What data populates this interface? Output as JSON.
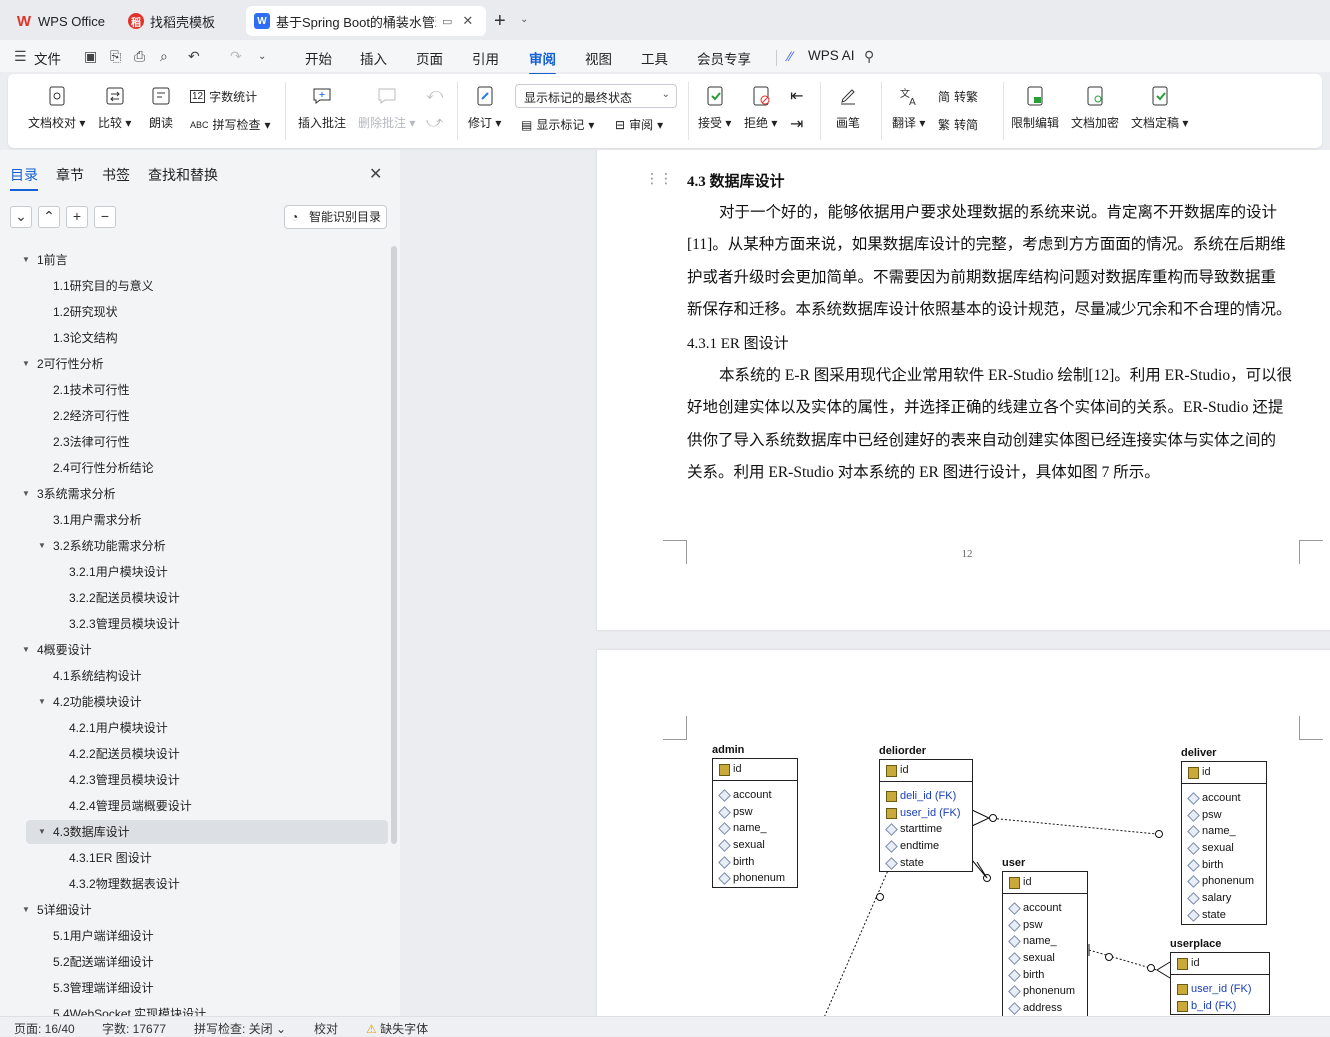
{
  "tabs": [
    {
      "label": "WPS Office",
      "icon": "wps-logo-icon"
    },
    {
      "label": "找稻壳模板",
      "icon": "docer-icon"
    },
    {
      "label": "基于Spring Boot的桶装水管理",
      "icon": "word-doc-icon"
    }
  ],
  "menu": {
    "file": "文件",
    "items": [
      "开始",
      "插入",
      "页面",
      "引用",
      "审阅",
      "视图",
      "工具",
      "会员专享"
    ],
    "active": "审阅",
    "ai": "WPS AI"
  },
  "ribbon": {
    "doc_check": "文档校对",
    "compare": "比较",
    "read_aloud": "朗读",
    "word_count": "字数统计",
    "spell_check": "拼写检查",
    "insert_comment": "插入批注",
    "delete_comment": "删除批注",
    "revise": "修订",
    "markup_state": "显示标记的最终状态",
    "show_markup": "显示标记",
    "review": "审阅",
    "accept": "接受",
    "reject": "拒绝",
    "pen": "画笔",
    "translate": "翻译",
    "to_traditional": "转繁",
    "to_simplified": "转简",
    "traditional_glyph": "繁",
    "restrict_edit": "限制编辑",
    "encrypt": "文档加密",
    "finalize": "文档定稿"
  },
  "nav": {
    "tabs": [
      "目录",
      "章节",
      "书签",
      "查找和替换"
    ],
    "smart_toc": "智能识别目录",
    "toc": [
      {
        "label": "1前言",
        "level": 1,
        "expanded": true
      },
      {
        "label": "1.1研究目的与意义",
        "level": 2
      },
      {
        "label": "1.2研究现状",
        "level": 2
      },
      {
        "label": "1.3论文结构",
        "level": 2
      },
      {
        "label": "2可行性分析",
        "level": 1,
        "expanded": true
      },
      {
        "label": "2.1技术可行性",
        "level": 2
      },
      {
        "label": "2.2经济可行性",
        "level": 2
      },
      {
        "label": "2.3法律可行性",
        "level": 2
      },
      {
        "label": "2.4可行性分析结论",
        "level": 2
      },
      {
        "label": "3系统需求分析",
        "level": 1,
        "expanded": true
      },
      {
        "label": "3.1用户需求分析",
        "level": 2
      },
      {
        "label": "3.2系统功能需求分析",
        "level": 2,
        "expanded": true
      },
      {
        "label": "3.2.1用户模块设计",
        "level": 3
      },
      {
        "label": "3.2.2配送员模块设计",
        "level": 3
      },
      {
        "label": "3.2.3管理员模块设计",
        "level": 3
      },
      {
        "label": "4概要设计",
        "level": 1,
        "expanded": true
      },
      {
        "label": "4.1系统结构设计",
        "level": 2
      },
      {
        "label": "4.2功能模块设计",
        "level": 2,
        "expanded": true
      },
      {
        "label": "4.2.1用户模块设计",
        "level": 3
      },
      {
        "label": "4.2.2配送员模块设计",
        "level": 3
      },
      {
        "label": "4.2.3管理员模块设计",
        "level": 3
      },
      {
        "label": "4.2.4管理员端概要设计",
        "level": 3
      },
      {
        "label": "4.3数据库设计",
        "level": 2,
        "expanded": true,
        "selected": true
      },
      {
        "label": "4.3.1ER 图设计",
        "level": 3
      },
      {
        "label": "4.3.2物理数据表设计",
        "level": 3
      },
      {
        "label": "5详细设计",
        "level": 1,
        "expanded": true
      },
      {
        "label": "5.1用户端详细设计",
        "level": 2
      },
      {
        "label": "5.2配送端详细设计",
        "level": 2
      },
      {
        "label": "5.3管理端详细设计",
        "level": 2
      },
      {
        "label": "5.4WebSocket 实现模块设计",
        "level": 2
      }
    ]
  },
  "doc": {
    "heading": "4.3  数据库设计",
    "para1_lines": [
      "对于一个好的，能够依据用户要求处理数据的系统来说。肯定离不开数据库的设计",
      "[11]。从某种方面来说，如果数据库设计的完整，考虑到方方面面的情况。系统在后期维",
      "护或者升级时会更加简单。不需要因为前期数据库结构问题对数据库重构而导致数据重",
      "新保存和迁移。本系统数据库设计依照基本的设计规范，尽量减少冗余和不合理的情况。"
    ],
    "subheading": "4.3.1  ER 图设计",
    "para2_lines": [
      "本系统的 E-R 图采用现代企业常用软件 ER-Studio 绘制[12]。利用 ER-Studio，可以很",
      "好地创建实体以及实体的属性，并选择正确的线建立各个实体间的关系。ER-Studio 还提",
      "供你了导入系统数据库中已经创建好的表来自动创建实体图已经连接实体与实体之间的",
      "关系。利用 ER-Studio 对本系统的 ER 图进行设计，具体如图 7 所示。"
    ],
    "page_number": "12"
  },
  "er": {
    "admin": {
      "name": "admin",
      "pk": "id",
      "attrs": [
        "account",
        "psw",
        "name_",
        "sexual",
        "birth",
        "phonenum"
      ]
    },
    "deliorder": {
      "name": "deliorder",
      "pk": "id",
      "fks": [
        "deli_id (FK)",
        "user_id (FK)"
      ],
      "attrs": [
        "starttime",
        "endtime",
        "state"
      ]
    },
    "deliver": {
      "name": "deliver",
      "pk": "id",
      "attrs": [
        "account",
        "psw",
        "name_",
        "sexual",
        "birth",
        "phonenum",
        "salary",
        "state"
      ]
    },
    "user": {
      "name": "user",
      "pk": "id",
      "attrs": [
        "account",
        "psw",
        "name_",
        "sexual",
        "birth",
        "phonenum",
        "address"
      ]
    },
    "userplace": {
      "name": "userplace",
      "pk": "id",
      "fks": [
        "user_id (FK)",
        "b_id (FK)"
      ],
      "attrs": []
    }
  },
  "status": {
    "page": "页面: 16/40",
    "words": "字数: 17677",
    "spell": "拼写检查: 关闭",
    "proof": "校对",
    "missing_font": "缺失字体"
  },
  "colors": {
    "accent": "#1560d4",
    "wps_red": "#e0342b"
  }
}
